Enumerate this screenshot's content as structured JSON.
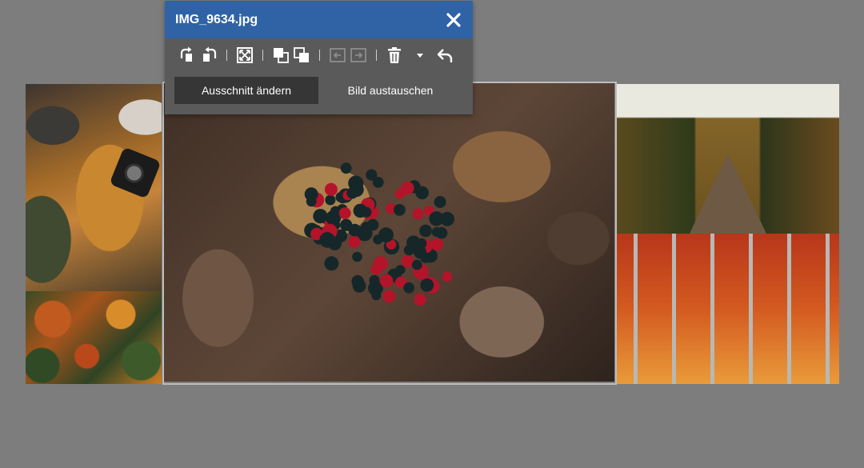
{
  "editor": {
    "title": "IMG_9634.jpg",
    "tabs": [
      "Ausschnitt ändern",
      "Bild austauschen"
    ],
    "active_tab": 0,
    "toolbar_icons": [
      "rotate-left-icon",
      "rotate-right-icon",
      "fit-icon",
      "bring-forward-icon",
      "send-backward-icon",
      "move-left-icon",
      "move-right-icon",
      "delete-icon",
      "dropdown-arrow-icon",
      "undo-icon"
    ]
  },
  "colors": {
    "header_blue": "#2f63a6",
    "panel_bg": "#5a5a5a",
    "active_tab_bg": "#363636",
    "canvas_bg": "#7d7d7d"
  }
}
